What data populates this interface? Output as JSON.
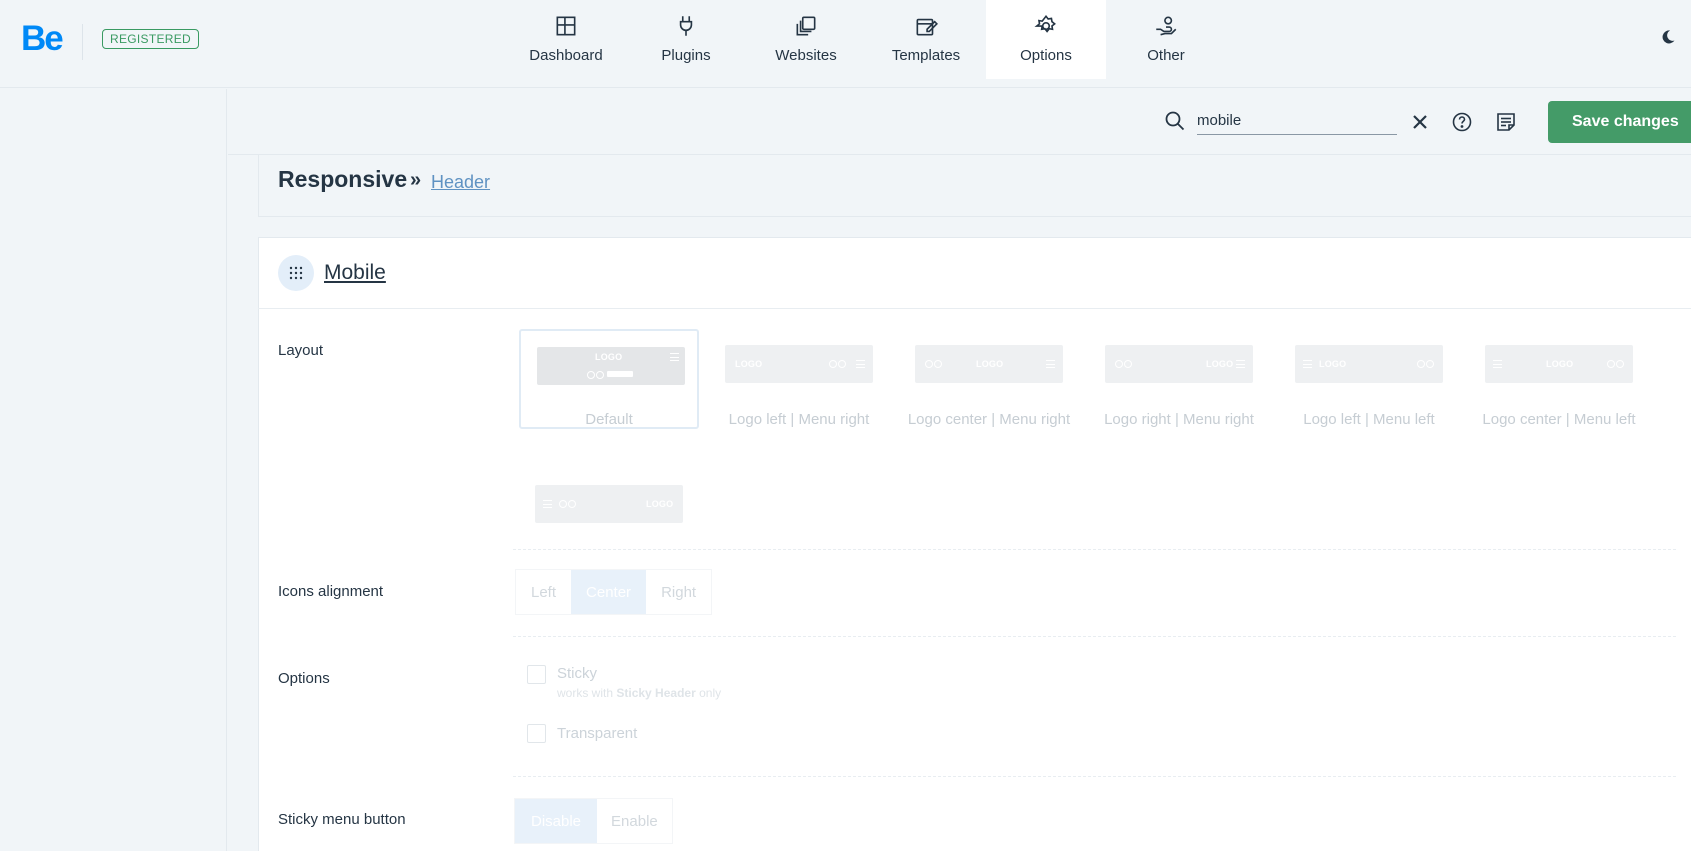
{
  "brand": {
    "logo": "Be",
    "badge": "REGISTERED"
  },
  "nav": [
    {
      "label": "Dashboard",
      "icon": "dashboard-icon"
    },
    {
      "label": "Plugins",
      "icon": "plug-icon"
    },
    {
      "label": "Websites",
      "icon": "websites-icon"
    },
    {
      "label": "Templates",
      "icon": "templates-icon"
    },
    {
      "label": "Options",
      "icon": "gear-icon",
      "active": true
    },
    {
      "label": "Other",
      "icon": "hand-user-icon"
    }
  ],
  "toolbar": {
    "search_value": "mobile",
    "save_label": "Save changes"
  },
  "breadcrumb": {
    "title": "Responsive",
    "separator": "»",
    "link": "Header"
  },
  "section": {
    "title": "Mobile"
  },
  "layout": {
    "label": "Layout",
    "options": [
      {
        "label": "Default",
        "thumb_text": "LOGO",
        "selected": true
      },
      {
        "label": "Logo left | Menu right",
        "thumb_text": "LOGO"
      },
      {
        "label": "Logo center | Menu right",
        "thumb_text": "LOGO"
      },
      {
        "label": "Logo right | Menu right",
        "thumb_text": "LOGO"
      },
      {
        "label": "Logo left | Menu left",
        "thumb_text": "LOGO"
      },
      {
        "label": "Logo center | Menu left",
        "thumb_text": "LOGO"
      },
      {
        "label": "",
        "thumb_text": "LOGO"
      }
    ]
  },
  "icons_alignment": {
    "label": "Icons alignment",
    "options": [
      "Left",
      "Center",
      "Right"
    ],
    "selected": "Center"
  },
  "options": {
    "label": "Options",
    "sticky": "Sticky",
    "sticky_note_prefix": "works with",
    "sticky_note_bold": "Sticky Header",
    "sticky_note_suffix": "only",
    "transparent": "Transparent"
  },
  "sticky_menu_button": {
    "label": "Sticky menu button",
    "options": [
      "Disable",
      "Enable"
    ],
    "selected": "Disable"
  },
  "colors": {
    "brand": "#0089f7",
    "save": "#449b68",
    "badge": "#3a9a62",
    "link": "#5f92c2"
  }
}
